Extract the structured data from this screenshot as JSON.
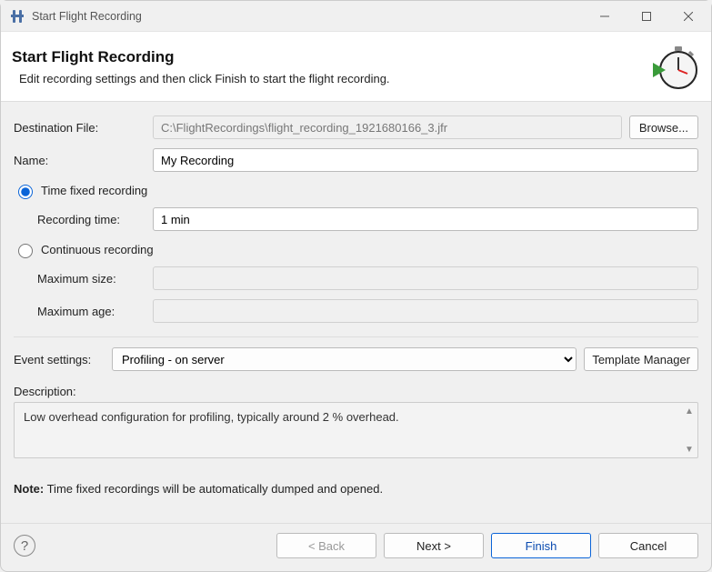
{
  "window": {
    "title": "Start Flight Recording"
  },
  "header": {
    "title": "Start Flight Recording",
    "description": "Edit recording settings and then click Finish to start the flight recording."
  },
  "form": {
    "destination_label": "Destination File:",
    "destination_value": "C:\\FlightRecordings\\flight_recording_1921680166_3.jfr",
    "browse_label": "Browse...",
    "name_label": "Name:",
    "name_value": "My Recording",
    "time_fixed_label": "Time fixed recording",
    "time_fixed_selected": true,
    "recording_time_label": "Recording time:",
    "recording_time_value": "1 min",
    "continuous_label": "Continuous recording",
    "continuous_selected": false,
    "max_size_label": "Maximum size:",
    "max_size_value": "",
    "max_age_label": "Maximum age:",
    "max_age_value": "",
    "event_settings_label": "Event settings:",
    "event_settings_value": "Profiling - on server",
    "template_manager_label": "Template Manager",
    "description_label": "Description:",
    "description_value": "Low overhead configuration for profiling, typically around 2 % overhead."
  },
  "note": {
    "prefix": "Note:",
    "text": " Time fixed recordings will be automatically dumped and opened."
  },
  "footer": {
    "back_label": "< Back",
    "next_label": "Next >",
    "finish_label": "Finish",
    "cancel_label": "Cancel"
  }
}
